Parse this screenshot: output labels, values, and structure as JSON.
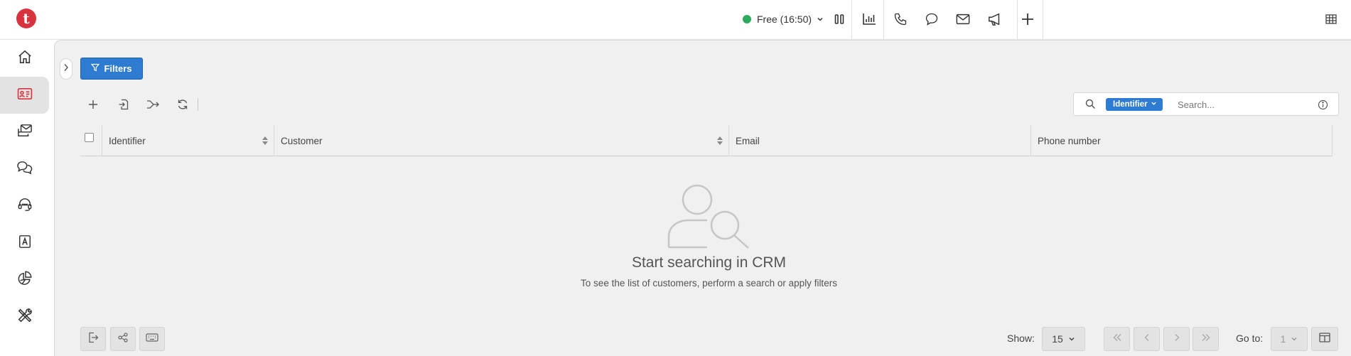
{
  "app": {
    "logo_letter": "t",
    "brand_color": "#d8343f",
    "accent_color": "#2e7bd2"
  },
  "topbar": {
    "status": {
      "label": "Free (16:50)",
      "color": "#2eaa5c"
    },
    "icons": [
      "pause-icon",
      "statistics-icon",
      "phone-icon",
      "chat-icon",
      "email-icon",
      "announcement-icon",
      "plus-icon",
      "grid-icon"
    ]
  },
  "sidebar": {
    "items": [
      {
        "icon": "home-icon",
        "active": false
      },
      {
        "icon": "contact-card-icon",
        "active": true
      },
      {
        "icon": "inbox-icon",
        "active": false
      },
      {
        "icon": "chats-icon",
        "active": false
      },
      {
        "icon": "headset-icon",
        "active": false
      },
      {
        "icon": "address-book-icon",
        "active": false
      },
      {
        "icon": "pie-chart-icon",
        "active": false
      },
      {
        "icon": "tools-icon",
        "active": false
      }
    ]
  },
  "toolbar": {
    "filters_label": "Filters",
    "actions": [
      "add-icon",
      "import-icon",
      "merge-icon",
      "refresh-icon"
    ]
  },
  "search": {
    "field_label": "Identifier",
    "placeholder": "Search..."
  },
  "table": {
    "columns": [
      {
        "label": "Identifier",
        "sortable": true
      },
      {
        "label": "Customer",
        "sortable": true
      },
      {
        "label": "Email",
        "sortable": false
      },
      {
        "label": "Phone number",
        "sortable": false
      }
    ]
  },
  "empty_state": {
    "title": "Start searching in CRM",
    "subtitle": "To see the list of customers, perform a search or apply filters"
  },
  "footer": {
    "show_label": "Show:",
    "page_size": "15",
    "goto_label": "Go to:",
    "goto_value": "1"
  }
}
